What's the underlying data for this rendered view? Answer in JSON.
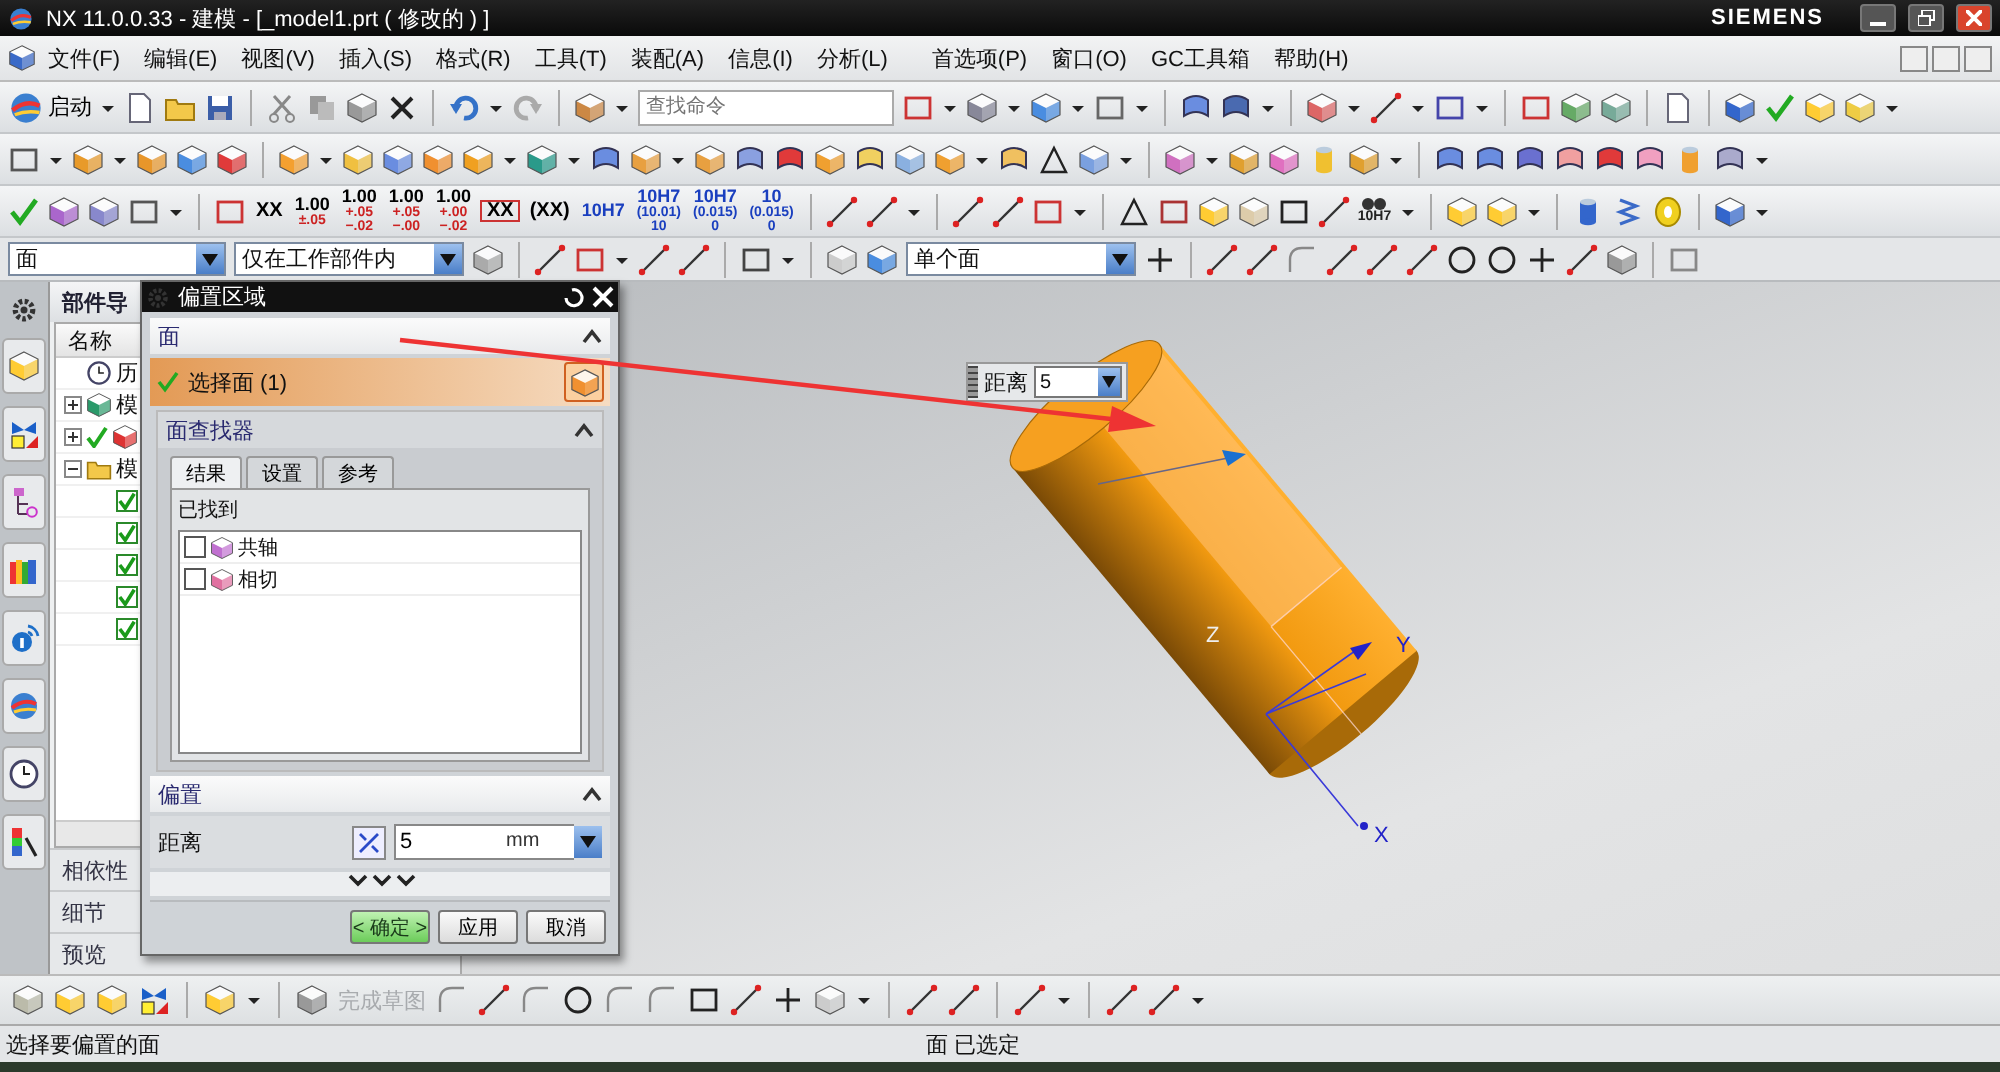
{
  "window": {
    "title": "NX 11.0.0.33 - 建模 - [_model1.prt  ( 修改的 ) ]",
    "brand": "SIEMENS"
  },
  "menu": [
    "文件(F)",
    "编辑(E)",
    "视图(V)",
    "插入(S)",
    "格式(R)",
    "工具(T)",
    "装配(A)",
    "信息(I)",
    "分析(L)",
    "首选项(P)",
    "窗口(O)",
    "GC工具箱",
    "帮助(H)"
  ],
  "toolbar": {
    "start_label": "启动",
    "search": {
      "placeholder": "查找命令"
    },
    "tolerance_buttons": [
      {
        "lines": [
          "XX"
        ],
        "kind": "plain"
      },
      {
        "lines": [
          "1.00",
          "±.05"
        ],
        "kind": "stacked"
      },
      {
        "lines": [
          "1.00",
          "+.05",
          "−.02"
        ],
        "kind": "stacked"
      },
      {
        "lines": [
          "1.00",
          "+.05",
          "−.00"
        ],
        "kind": "stacked"
      },
      {
        "lines": [
          "1.00",
          "+.00",
          "−.02"
        ],
        "kind": "stacked"
      },
      {
        "lines": [
          "XX"
        ],
        "kind": "boxed"
      },
      {
        "lines": [
          "(XX)"
        ],
        "kind": "plain"
      },
      {
        "lines": [
          "10H7"
        ],
        "kind": "fit"
      },
      {
        "lines": [
          "10H7",
          "(10.01)",
          "10"
        ],
        "kind": "fit"
      },
      {
        "lines": [
          "10H7",
          "(0.015)",
          "0"
        ],
        "kind": "fit"
      },
      {
        "lines": [
          "10",
          "(0.015)",
          "0"
        ],
        "kind": "fit"
      }
    ],
    "fit_label": "10H7"
  },
  "selection_bar": {
    "filter": "面",
    "scope": "仅在工作部件内",
    "rule": "单个面"
  },
  "navigator": {
    "title": "部件导",
    "column": "名称",
    "nodes": [
      {
        "label": "历",
        "kind": "history"
      },
      {
        "label": "模",
        "expanded": false,
        "kind": "model"
      },
      {
        "expanded": false,
        "kind": "feature",
        "checked": true
      },
      {
        "label": "模",
        "expanded": true,
        "kind": "folder",
        "children": [
          {
            "checked": true
          },
          {
            "checked": true
          },
          {
            "checked": true
          },
          {
            "checked": true
          },
          {
            "checked": true
          }
        ]
      }
    ],
    "sections": [
      "相依性",
      "细节",
      "预览"
    ]
  },
  "dialog": {
    "title": "偏置区域",
    "face_group": {
      "title": "面",
      "expanded": true,
      "select_row": {
        "label": "选择面 (1)",
        "selected": true
      },
      "finder": {
        "title": "面查找器",
        "tabs": [
          {
            "label": "结果",
            "selected": true
          },
          {
            "label": "设置",
            "selected": false
          },
          {
            "label": "参考",
            "selected": false
          }
        ],
        "found_label": "已找到",
        "items": [
          {
            "label": "共轴",
            "checked": false
          },
          {
            "label": "相切",
            "checked": false
          }
        ]
      }
    },
    "offset_group": {
      "title": "偏置",
      "distance_label": "距离",
      "value": "5",
      "unit": "mm"
    },
    "buttons": [
      {
        "label": "< 确定 >",
        "kind": "default"
      },
      {
        "label": "应用",
        "kind": "normal"
      },
      {
        "label": "取消",
        "kind": "normal"
      }
    ]
  },
  "canvas": {
    "distance_box": {
      "label": "距离",
      "value": "5"
    },
    "axis_labels": [
      "Y",
      "X",
      "Z"
    ]
  },
  "bottom_toolbar": {
    "finish_sketch": {
      "label": "完成草图",
      "disabled": true
    }
  },
  "status_bar": {
    "prompt": "选择要偏置的面",
    "selection": "面 已选定"
  }
}
